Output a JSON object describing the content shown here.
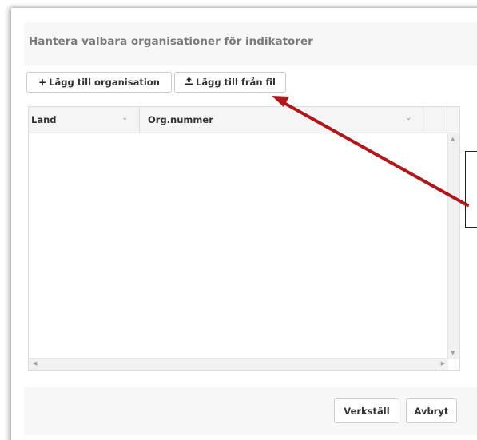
{
  "dialog": {
    "title": "Hantera valbara organisationer för indikatorer"
  },
  "toolbar": {
    "add_org_icon": "+",
    "add_org_label": "Lägg till organisation",
    "add_file_icon": "upload-icon",
    "add_file_label": "Lägg till från fil"
  },
  "grid": {
    "columns": [
      {
        "label": "Land"
      },
      {
        "label": "Org.nummer"
      },
      {
        "label": ""
      }
    ],
    "rows": []
  },
  "footer": {
    "apply_label": "Verkställ",
    "cancel_label": "Avbryt"
  },
  "annotation": {
    "arrow_color": "#b0171b"
  }
}
